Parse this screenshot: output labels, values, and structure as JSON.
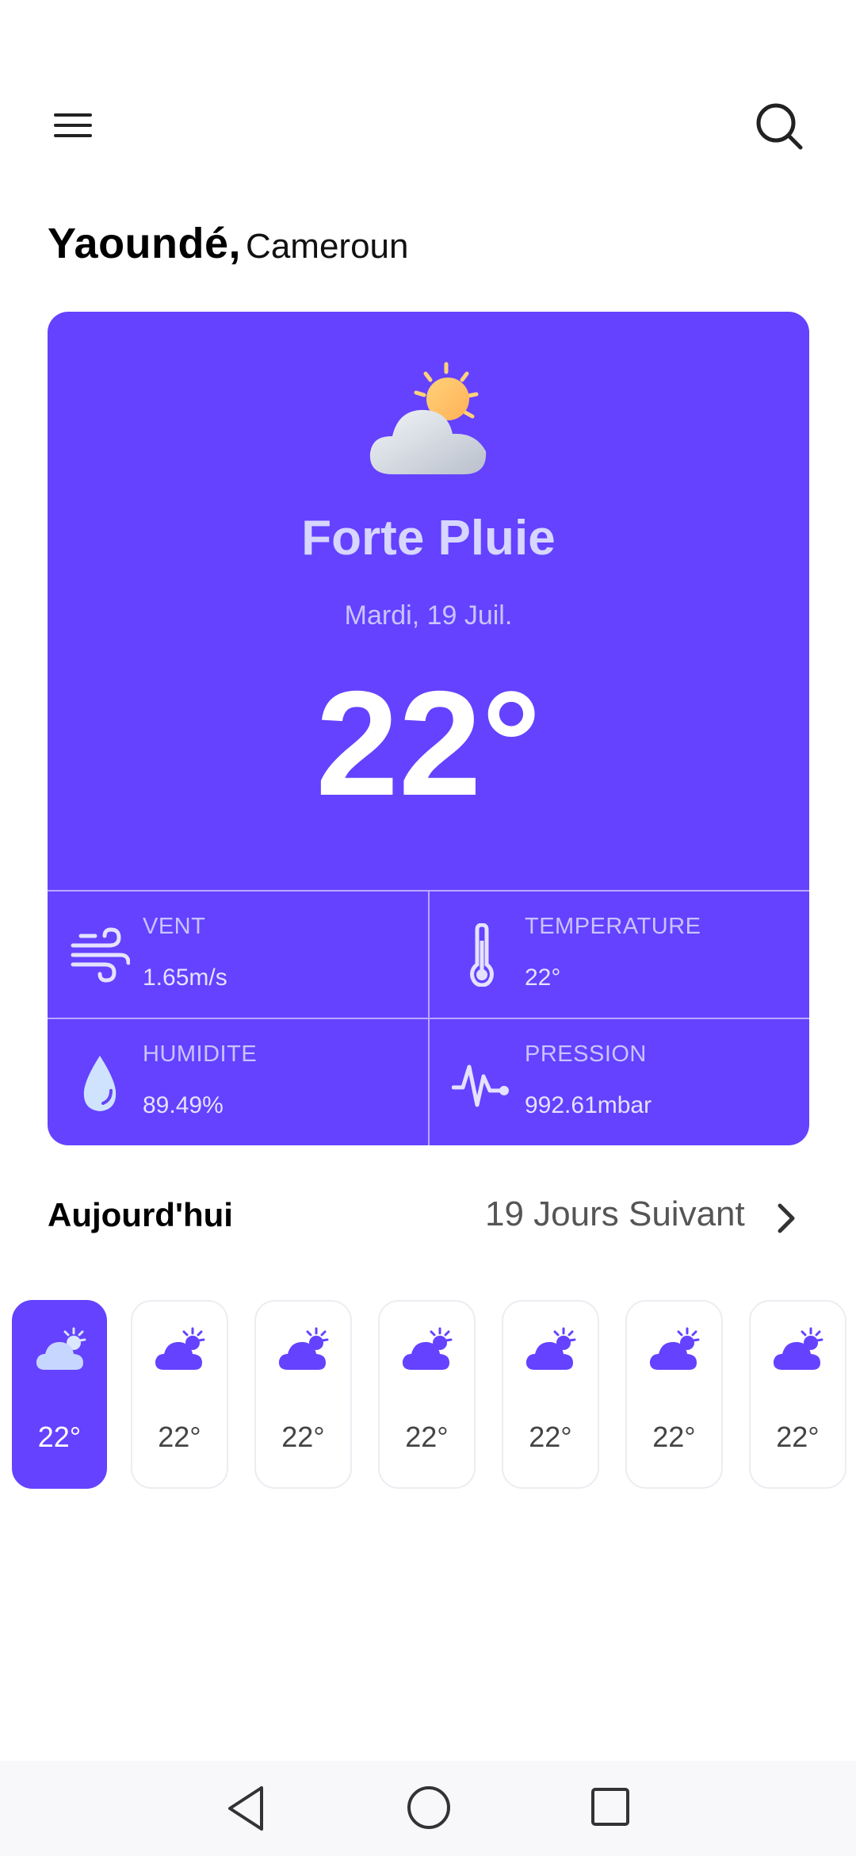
{
  "header": {
    "menu_icon": "menu-icon",
    "search_icon": "search-icon"
  },
  "location": {
    "city": "Yaoundé,",
    "country": "Cameroun"
  },
  "current": {
    "condition": "Forte Pluie",
    "date": "Mardi, 19 Juil.",
    "temperature": "22°",
    "icon": "partly-cloudy-icon"
  },
  "stats": [
    {
      "label": "VENT",
      "value": "1.65m/s",
      "icon": "wind-icon"
    },
    {
      "label": "TEMPERATURE",
      "value": "22°",
      "icon": "thermometer-icon"
    },
    {
      "label": "HUMIDITE",
      "value": "89.49%",
      "icon": "droplet-icon"
    },
    {
      "label": "PRESSION",
      "value": "992.61mbar",
      "icon": "pulse-icon"
    }
  ],
  "forecast": {
    "today_label": "Aujourd'hui",
    "next_label": "19 Jours Suivant",
    "days": [
      {
        "temp": "22°",
        "active": true
      },
      {
        "temp": "22°",
        "active": false
      },
      {
        "temp": "22°",
        "active": false
      },
      {
        "temp": "22°",
        "active": false
      },
      {
        "temp": "22°",
        "active": false
      },
      {
        "temp": "22°",
        "active": false
      },
      {
        "temp": "22°",
        "active": false
      }
    ]
  },
  "colors": {
    "accent": "#6442ff",
    "card_text": "#d7d6ff",
    "background": "#ffffff"
  },
  "navbar": {
    "back_icon": "back-triangle-icon",
    "home_icon": "home-circle-icon",
    "recents_icon": "recents-square-icon"
  }
}
